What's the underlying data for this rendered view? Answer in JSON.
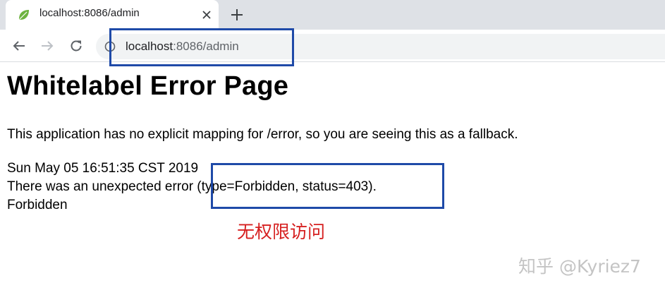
{
  "browser": {
    "tab_title": "localhost:8086/admin",
    "url_host": "localhost",
    "url_rest": ":8086/admin"
  },
  "page": {
    "title": "Whitelabel Error Page",
    "description": "This application has no explicit mapping for /error, so you are seeing this as a fallback.",
    "timestamp": "Sun May 05 16:51:35 CST 2019",
    "error_line": "There was an unexpected error (type=Forbidden, status=403).",
    "status_text": "Forbidden"
  },
  "annotation": {
    "note": "无权限访问"
  },
  "watermark": "知乎 @Kyriez7",
  "colors": {
    "tabstrip": "#dee1e6",
    "annotation_box": "#1f4aa8",
    "annotation_text": "#d62020",
    "watermark": "#c4c4c4"
  }
}
